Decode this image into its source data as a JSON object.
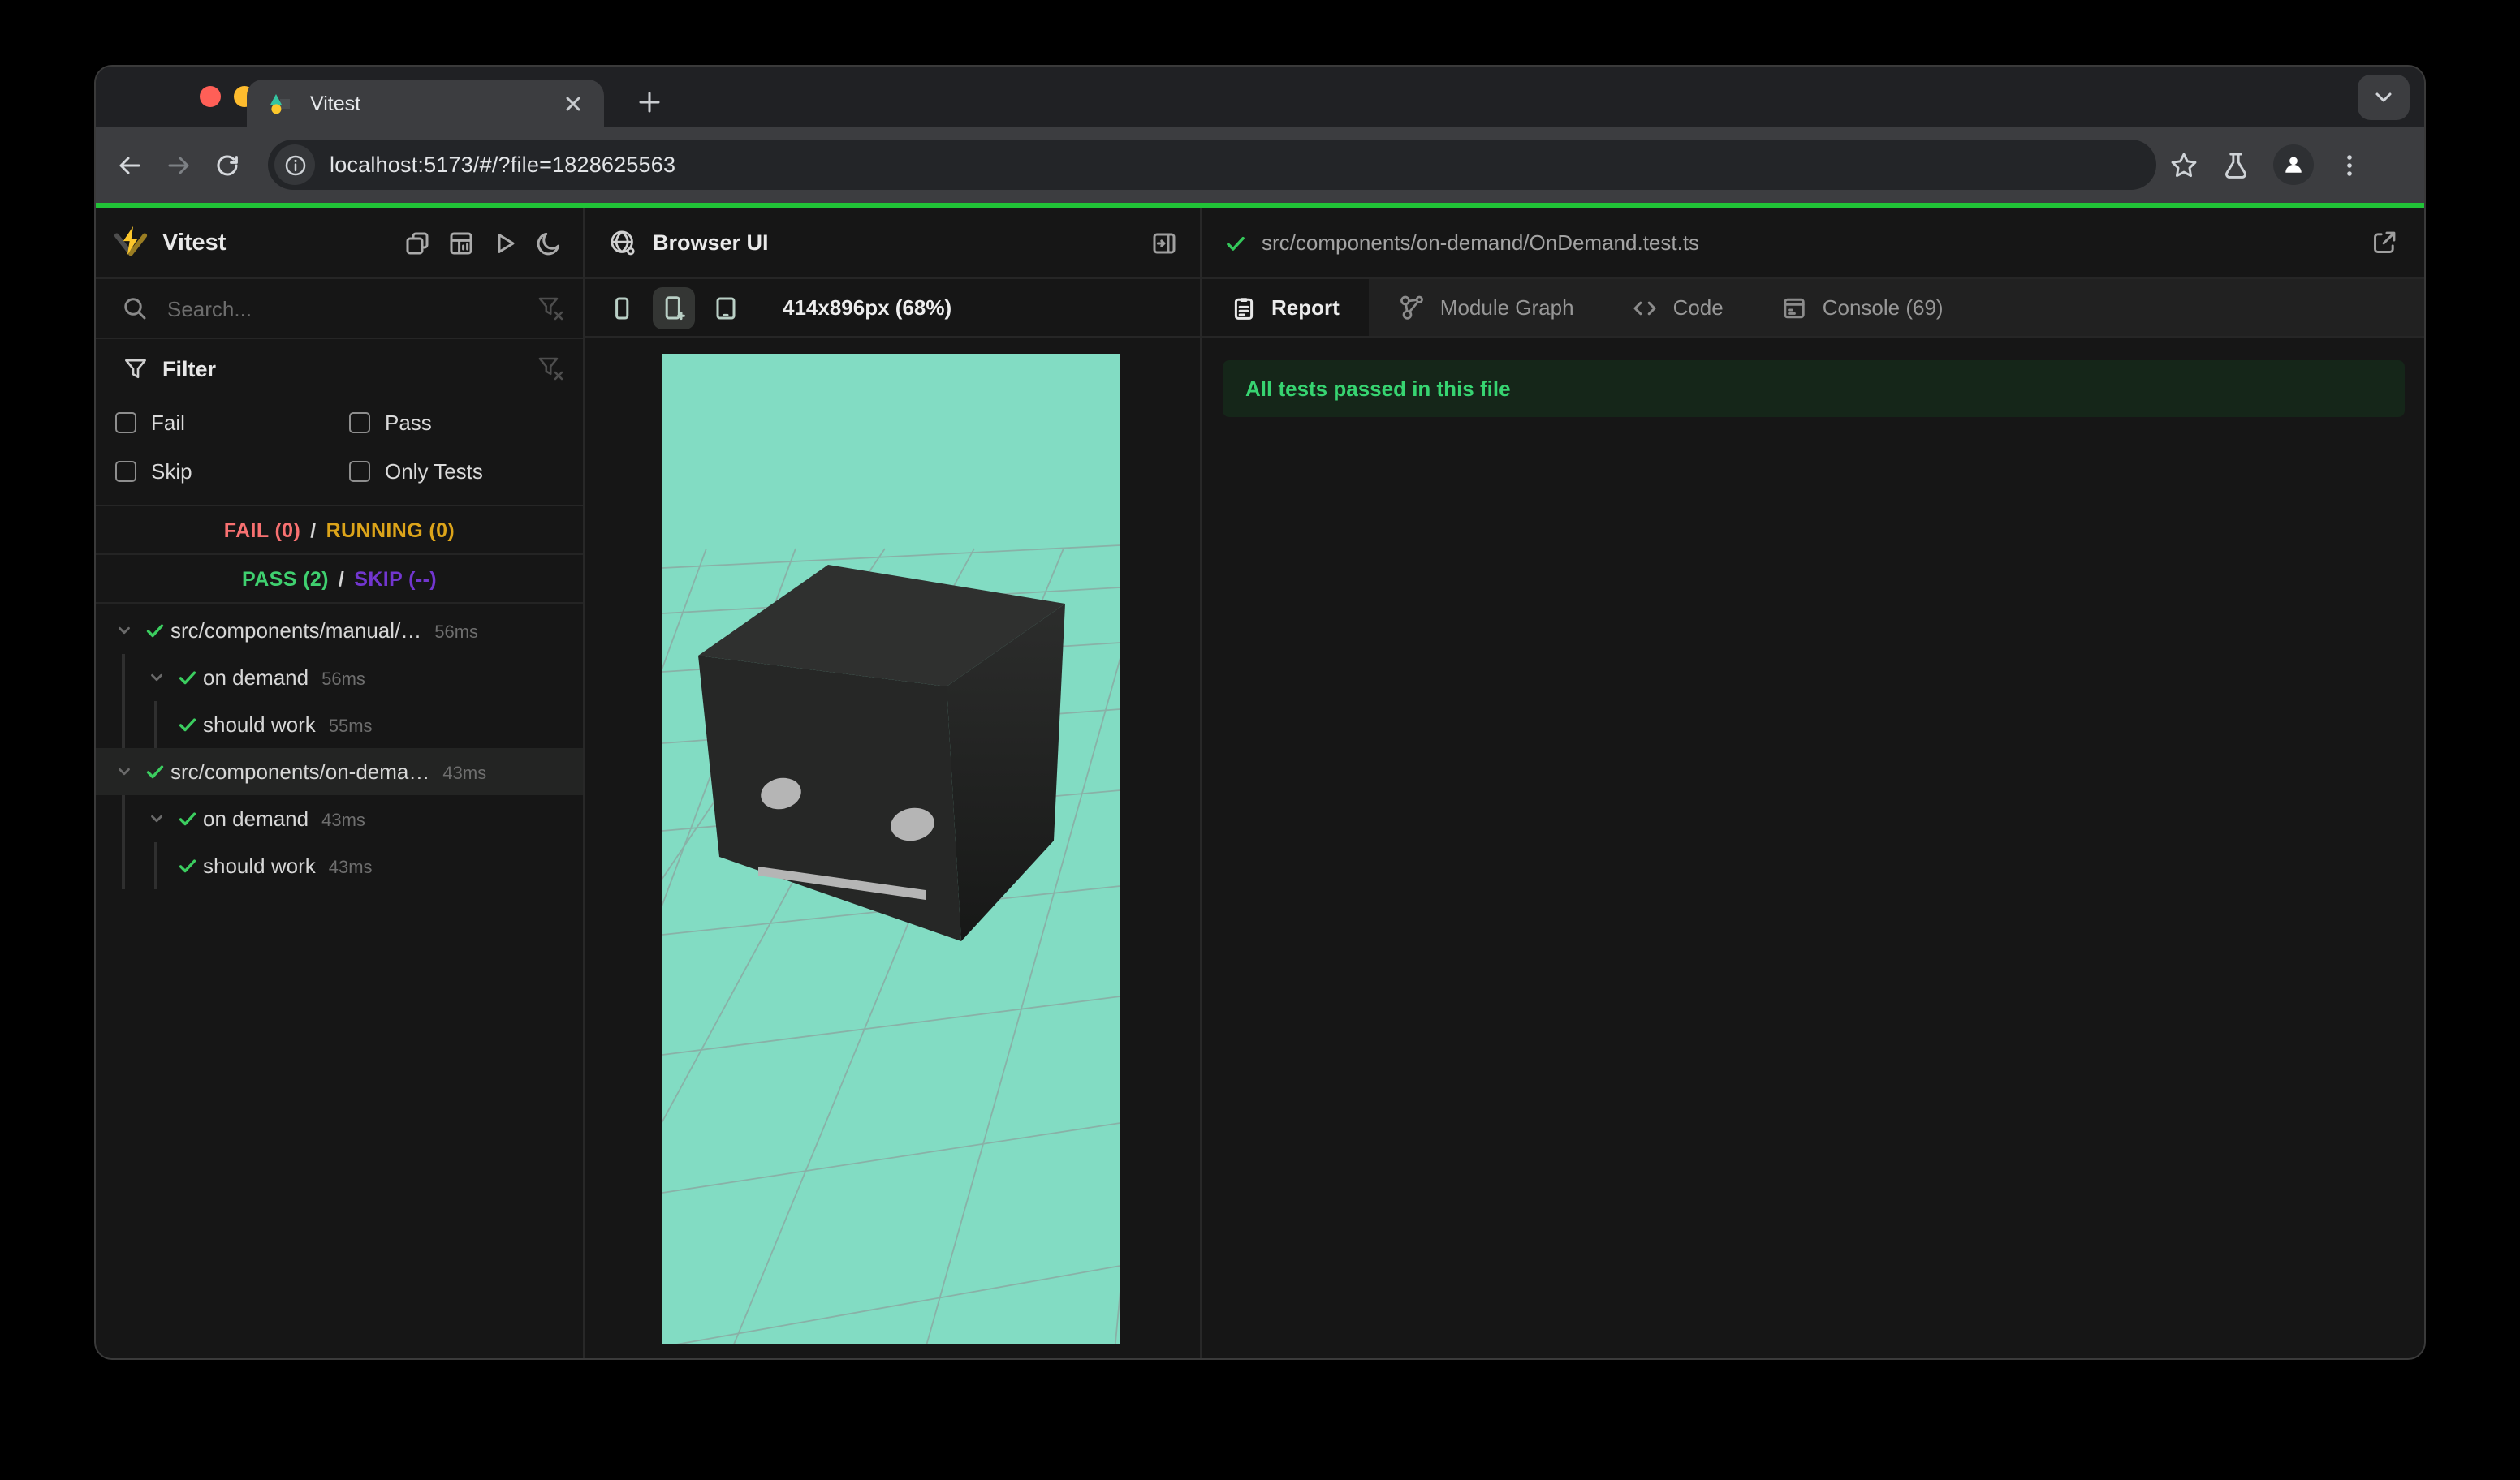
{
  "browser": {
    "tab_title": "Vitest",
    "url": "localhost:5173/#/?file=1828625563"
  },
  "sidebar": {
    "app_title": "Vitest",
    "search_placeholder": "Search...",
    "filter": {
      "title": "Filter",
      "options": [
        "Fail",
        "Pass",
        "Skip",
        "Only Tests"
      ]
    },
    "status": {
      "fail": "FAIL (0)",
      "running": "RUNNING (0)",
      "pass": "PASS (2)",
      "skip": "SKIP (--)",
      "sep": "/"
    },
    "tree": [
      {
        "level": 1,
        "chevron": true,
        "label": "src/components/manual/…",
        "duration": "56ms",
        "selected": false
      },
      {
        "level": 2,
        "chevron": true,
        "label": "on demand",
        "duration": "56ms",
        "selected": false
      },
      {
        "level": 3,
        "chevron": false,
        "label": "should work",
        "duration": "55ms",
        "selected": false
      },
      {
        "level": 1,
        "chevron": true,
        "label": "src/components/on-dema…",
        "duration": "43ms",
        "selected": true
      },
      {
        "level": 2,
        "chevron": true,
        "label": "on demand",
        "duration": "43ms",
        "selected": false
      },
      {
        "level": 3,
        "chevron": false,
        "label": "should work",
        "duration": "43ms",
        "selected": false
      }
    ]
  },
  "browser_panel": {
    "title": "Browser UI",
    "viewport_label": "414x896px (68%)"
  },
  "report_panel": {
    "file_path": "src/components/on-demand/OnDemand.test.ts",
    "tabs": [
      {
        "label": "Report",
        "icon": "report",
        "active": true
      },
      {
        "label": "Module Graph",
        "icon": "module-graph",
        "active": false
      },
      {
        "label": "Code",
        "icon": "code",
        "active": false
      },
      {
        "label": "Console (69)",
        "icon": "console",
        "active": false
      }
    ],
    "banner": "All tests passed in this file"
  },
  "colors": {
    "progress_green": "#21c337",
    "pass_green": "#3fd06f",
    "fail_red": "#f87171",
    "running_yellow": "#dca41a",
    "skip_purple": "#7236cf",
    "viewport_mint": "#82dcc3",
    "banner_bg": "#152619",
    "logo_yellow": "#fcc72b"
  }
}
